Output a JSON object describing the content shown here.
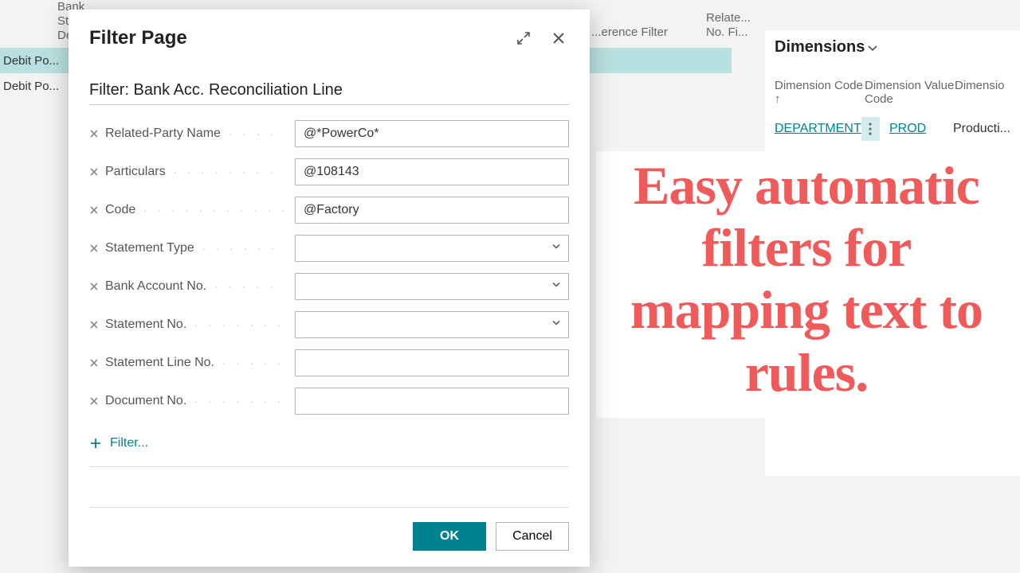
{
  "background": {
    "col_headers": {
      "bank": "Bank",
      "st": "St...",
      "de": "De...",
      "ref_filter": "...erence Filter",
      "relate": "Relate...",
      "nofi": "No. Fi..."
    },
    "rows": [
      "Debit Po...",
      "Debit Po..."
    ]
  },
  "dimensions": {
    "title": "Dimensions",
    "headers": {
      "code": "Dimension Code ↑",
      "value": "Dimension Value Code",
      "caption": "Dimensio"
    },
    "data": {
      "code": "DEPARTMENT",
      "value": "PROD",
      "caption": "Producti..."
    }
  },
  "annotation": "Easy automatic filters for mapping text to rules.",
  "modal": {
    "title": "Filter Page",
    "section_title": "Filter: Bank Acc. Reconciliation Line",
    "rows": [
      {
        "label": "Related-Party Name",
        "value": "@*PowerCo*",
        "type": "text"
      },
      {
        "label": "Particulars",
        "value": "@108143",
        "type": "text"
      },
      {
        "label": "Code",
        "value": "@Factory",
        "type": "text"
      },
      {
        "label": "Statement Type",
        "value": "",
        "type": "select"
      },
      {
        "label": "Bank Account No.",
        "value": "",
        "type": "select"
      },
      {
        "label": "Statement No.",
        "value": "",
        "type": "select"
      },
      {
        "label": "Statement Line No.",
        "value": "",
        "type": "text"
      },
      {
        "label": "Document No.",
        "value": "",
        "type": "text"
      }
    ],
    "add_filter_label": "Filter...",
    "ok_label": "OK",
    "cancel_label": "Cancel"
  }
}
